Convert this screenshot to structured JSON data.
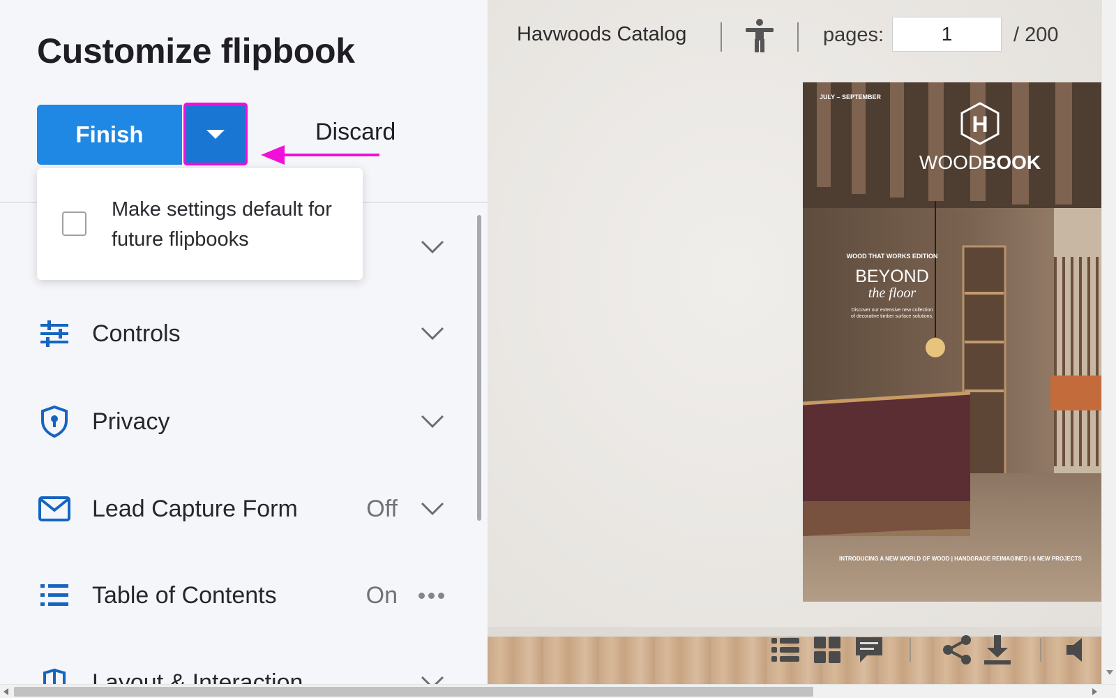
{
  "panel": {
    "title": "Customize flipbook",
    "finish_label": "Finish",
    "discard_label": "Discard",
    "popover": {
      "checkbox_checked": false,
      "checkbox_label": "Make settings default for future flipbooks"
    },
    "rows": [
      {
        "id": "controls",
        "label": "Controls",
        "status": "",
        "icon": "sliders-icon",
        "action": "chevron-down-icon"
      },
      {
        "id": "privacy",
        "label": "Privacy",
        "status": "",
        "icon": "shield-lock-icon",
        "action": "chevron-down-icon"
      },
      {
        "id": "lead-capture-form",
        "label": "Lead Capture Form",
        "status": "Off",
        "icon": "envelope-icon",
        "action": "chevron-down-icon"
      },
      {
        "id": "table-of-contents",
        "label": "Table of Contents",
        "status": "On",
        "icon": "list-icon",
        "action": "more-icon"
      },
      {
        "id": "layout-interaction",
        "label": "Layout & Interaction",
        "status": "",
        "icon": "book-icon",
        "action": "chevron-down-icon"
      }
    ]
  },
  "viewer": {
    "catalog_title": "Havwoods Catalog",
    "pages_label": "pages:",
    "current_page": "1",
    "total_pages": "/  200",
    "cover": {
      "date_range": "JULY – SEPTEMBER",
      "logo_letter": "H",
      "brand_light": "WOOD",
      "brand_bold": "BOOK",
      "edition": "WOOD THAT WORKS EDITION",
      "headline": "BEYOND",
      "subheadline": "the floor",
      "blurb_line1": "Discover our extensive new collection",
      "blurb_line2": "of decorative timber surface solutions.",
      "footer": "INTRODUCING A NEW WORLD OF WOOD | HANDGRADE REIMAGINED | 6 NEW PROJECTS"
    },
    "toolbar_icons": [
      "toc-list-icon",
      "thumbnails-grid-icon",
      "comments-icon",
      "share-icon",
      "download-icon",
      "sound-icon"
    ]
  },
  "colors": {
    "accent": "#1f88e5",
    "highlight": "#f10fd9",
    "icon_blue": "#1565c0"
  }
}
